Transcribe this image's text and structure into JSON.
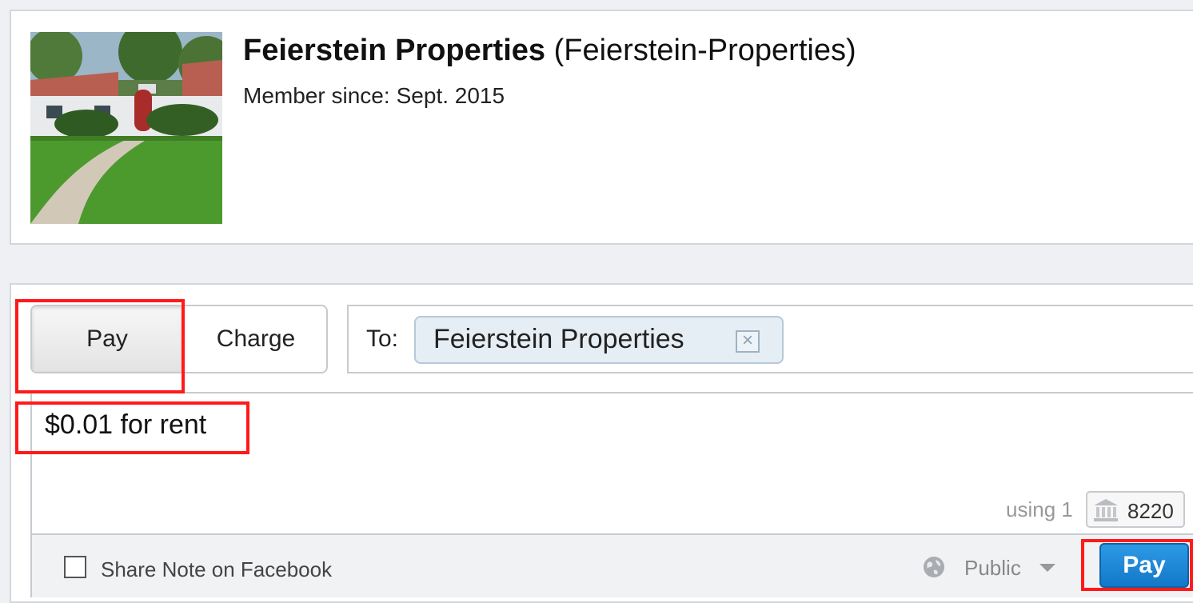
{
  "profile": {
    "display_name": "Feierstein Properties",
    "username_paren": "(Feierstein-Properties)",
    "member_since_label": "Member since:",
    "member_since_value": "Sept. 2015"
  },
  "payment": {
    "mode_tabs": {
      "pay_label": "Pay",
      "charge_label": "Charge",
      "selected": "Pay"
    },
    "to_label": "To:",
    "recipient": "Feierstein Properties",
    "remove_symbol": "×",
    "note": "$0.01 for rent",
    "using_text": "using 1",
    "funding_account_last4": "8220",
    "share_facebook_label": "Share Note on Facebook",
    "share_facebook_checked": false,
    "privacy_label": "Public",
    "submit_label": "Pay"
  },
  "icons": [
    "bank-icon",
    "globe-icon",
    "chevron-down-icon",
    "close-icon"
  ],
  "colors": {
    "accent_blue": "#1a86d8",
    "highlight_red": "#ff1a1a",
    "token_bg": "#e6eef5"
  }
}
